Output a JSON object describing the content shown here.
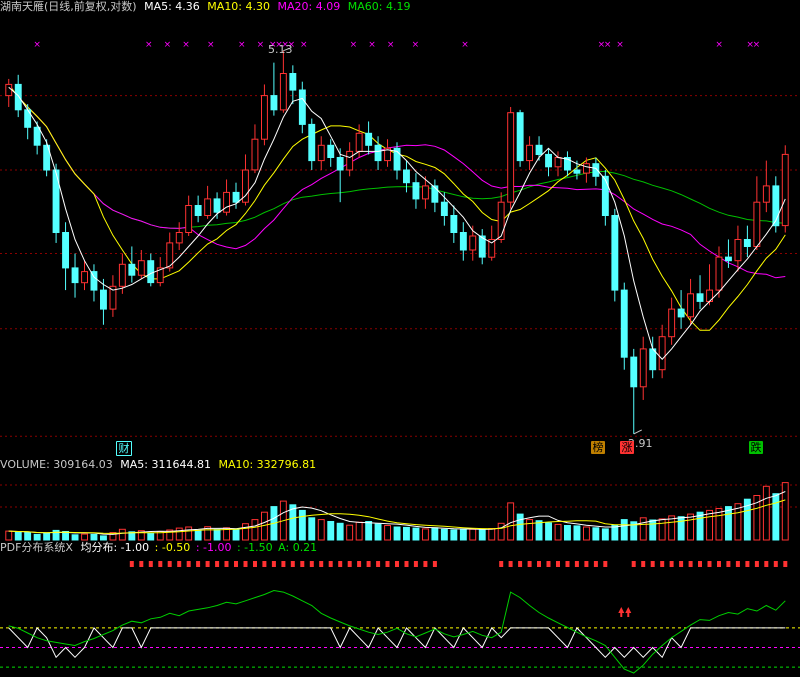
{
  "main_header": {
    "title": "湖南天雁(日线,前复权,对数)",
    "ma5": "MA5: 4.36",
    "ma10": "MA10: 4.30",
    "ma20": "MA20: 4.09",
    "ma60": "MA60: 4.19"
  },
  "volume_header": {
    "title": "VOLUME: 309164.03",
    "ma5": "MA5: 311644.81",
    "ma10": "MA10: 332796.81"
  },
  "indicator_header": {
    "title": "PDF分布系统X",
    "avg": "均分布: -1.00",
    "v1": ": -0.50",
    "v2": ": -1.00",
    "v3": ": -1.50",
    "a": "A: 0.21"
  },
  "annotations": {
    "high_label": "5.13",
    "low_label": "2.91",
    "tag_cai": "财",
    "tag_bang": "榜",
    "tag_zhang": "涨",
    "tag_die": "跌"
  },
  "colors": {
    "background": "#000000",
    "up": "#ff3232",
    "down": "#54ffff",
    "ma5": "#ffffff",
    "ma10": "#ffff00",
    "ma20": "#ff00ff",
    "ma60": "#00c000",
    "grid": "#8b0000"
  },
  "chart_data": [
    {
      "type": "candlestick",
      "title": "湖南天雁(日线,前复权,对数)",
      "scale": "log",
      "ylim": [
        2.85,
        5.4
      ],
      "high": 5.13,
      "low": 2.91,
      "candles": [
        [
          4.8,
          4.88,
          4.92,
          4.72
        ],
        [
          4.88,
          4.7,
          4.95,
          4.65
        ],
        [
          4.7,
          4.58,
          4.74,
          4.5
        ],
        [
          4.58,
          4.46,
          4.62,
          4.4
        ],
        [
          4.46,
          4.3,
          4.5,
          4.26
        ],
        [
          4.3,
          3.92,
          4.34,
          3.86
        ],
        [
          3.92,
          3.72,
          3.98,
          3.6
        ],
        [
          3.72,
          3.64,
          3.8,
          3.56
        ],
        [
          3.64,
          3.7,
          3.76,
          3.6
        ],
        [
          3.7,
          3.6,
          3.74,
          3.54
        ],
        [
          3.6,
          3.5,
          3.66,
          3.42
        ],
        [
          3.5,
          3.62,
          3.68,
          3.46
        ],
        [
          3.62,
          3.74,
          3.8,
          3.58
        ],
        [
          3.74,
          3.68,
          3.84,
          3.64
        ],
        [
          3.68,
          3.76,
          3.82,
          3.66
        ],
        [
          3.76,
          3.64,
          3.8,
          3.62
        ],
        [
          3.64,
          3.72,
          3.78,
          3.62
        ],
        [
          3.72,
          3.86,
          3.92,
          3.7
        ],
        [
          3.86,
          3.92,
          3.98,
          3.82
        ],
        [
          3.92,
          4.08,
          4.14,
          3.9
        ],
        [
          4.08,
          4.02,
          4.14,
          3.98
        ],
        [
          4.02,
          4.12,
          4.2,
          4.0
        ],
        [
          4.12,
          4.04,
          4.16,
          4.0
        ],
        [
          4.04,
          4.16,
          4.24,
          4.02
        ],
        [
          4.16,
          4.1,
          4.22,
          4.06
        ],
        [
          4.1,
          4.3,
          4.4,
          4.08
        ],
        [
          4.3,
          4.5,
          4.6,
          4.28
        ],
        [
          4.5,
          4.8,
          4.88,
          4.46
        ],
        [
          4.8,
          4.7,
          5.04,
          4.66
        ],
        [
          4.7,
          4.96,
          5.13,
          4.68
        ],
        [
          4.96,
          4.84,
          5.02,
          4.74
        ],
        [
          4.84,
          4.6,
          4.9,
          4.54
        ],
        [
          4.6,
          4.36,
          4.64,
          4.3
        ],
        [
          4.36,
          4.46,
          4.52,
          4.3
        ],
        [
          4.46,
          4.38,
          4.5,
          4.32
        ],
        [
          4.38,
          4.3,
          4.44,
          4.1
        ],
        [
          4.3,
          4.42,
          4.48,
          4.26
        ],
        [
          4.42,
          4.54,
          4.6,
          4.38
        ],
        [
          4.54,
          4.46,
          4.62,
          4.4
        ],
        [
          4.46,
          4.36,
          4.52,
          4.3
        ],
        [
          4.36,
          4.44,
          4.5,
          4.32
        ],
        [
          4.44,
          4.3,
          4.48,
          4.24
        ],
        [
          4.3,
          4.22,
          4.36,
          4.16
        ],
        [
          4.22,
          4.12,
          4.28,
          4.06
        ],
        [
          4.12,
          4.2,
          4.26,
          4.06
        ],
        [
          4.2,
          4.1,
          4.24,
          4.04
        ],
        [
          4.1,
          4.02,
          4.16,
          3.96
        ],
        [
          4.02,
          3.92,
          4.08,
          3.86
        ],
        [
          3.92,
          3.82,
          3.98,
          3.76
        ],
        [
          3.82,
          3.9,
          3.96,
          3.76
        ],
        [
          3.9,
          3.78,
          3.94,
          3.74
        ],
        [
          3.78,
          3.88,
          3.96,
          3.76
        ],
        [
          3.88,
          4.1,
          4.16,
          3.86
        ],
        [
          4.1,
          4.68,
          4.72,
          4.06
        ],
        [
          4.68,
          4.36,
          4.7,
          4.32
        ],
        [
          4.36,
          4.46,
          4.52,
          4.3
        ],
        [
          4.46,
          4.4,
          4.52,
          4.36
        ],
        [
          4.4,
          4.32,
          4.44,
          4.26
        ],
        [
          4.32,
          4.38,
          4.42,
          4.26
        ],
        [
          4.38,
          4.3,
          4.42,
          4.26
        ],
        [
          4.3,
          4.28,
          4.36,
          4.24
        ],
        [
          4.28,
          4.34,
          4.38,
          4.22
        ],
        [
          4.34,
          4.26,
          4.38,
          4.2
        ],
        [
          4.26,
          4.02,
          4.3,
          3.96
        ],
        [
          4.02,
          3.6,
          4.06,
          3.54
        ],
        [
          3.6,
          3.26,
          3.64,
          3.2
        ],
        [
          3.26,
          3.12,
          3.3,
          2.91
        ],
        [
          3.12,
          3.3,
          3.36,
          3.06
        ],
        [
          3.3,
          3.2,
          3.36,
          3.16
        ],
        [
          3.2,
          3.36,
          3.42,
          3.16
        ],
        [
          3.36,
          3.5,
          3.56,
          3.32
        ],
        [
          3.5,
          3.46,
          3.6,
          3.4
        ],
        [
          3.46,
          3.58,
          3.66,
          3.42
        ],
        [
          3.58,
          3.54,
          3.68,
          3.5
        ],
        [
          3.54,
          3.6,
          3.74,
          3.52
        ],
        [
          3.6,
          3.78,
          3.84,
          3.56
        ],
        [
          3.78,
          3.76,
          3.88,
          3.72
        ],
        [
          3.76,
          3.88,
          3.96,
          3.7
        ],
        [
          3.88,
          3.84,
          3.96,
          3.78
        ],
        [
          3.84,
          4.1,
          4.26,
          3.82
        ],
        [
          4.1,
          4.2,
          4.36,
          4.04
        ],
        [
          4.2,
          3.96,
          4.26,
          3.92
        ],
        [
          3.96,
          4.4,
          4.46,
          3.92
        ]
      ],
      "ma5": [
        4.86,
        4.8,
        4.7,
        4.6,
        4.48,
        4.28,
        4.06,
        3.88,
        3.76,
        3.67,
        3.63,
        3.6,
        3.61,
        3.63,
        3.66,
        3.69,
        3.71,
        3.73,
        3.78,
        3.84,
        3.9,
        3.97,
        4.03,
        4.07,
        4.09,
        4.14,
        4.22,
        4.37,
        4.5,
        4.65,
        4.76,
        4.78,
        4.69,
        4.64,
        4.52,
        4.4,
        4.38,
        4.42,
        4.42,
        4.42,
        4.43,
        4.42,
        4.36,
        4.29,
        4.24,
        4.19,
        4.13,
        4.07,
        4.01,
        3.93,
        3.89,
        3.86,
        3.9,
        4.05,
        4.16,
        4.28,
        4.38,
        4.44,
        4.38,
        4.37,
        4.34,
        4.32,
        4.31,
        4.24,
        4.1,
        3.9,
        3.65,
        3.46,
        3.3,
        3.25,
        3.3,
        3.36,
        3.42,
        3.49,
        3.54,
        3.59,
        3.65,
        3.71,
        3.77,
        3.84,
        3.91,
        3.99,
        4.12
      ]
    },
    {
      "type": "bar",
      "title": "VOLUME: 309164.03",
      "series": [
        {
          "values": [
            48,
            44,
            40,
            30,
            36,
            52,
            46,
            28,
            32,
            30,
            22,
            40,
            58,
            44,
            50,
            38,
            46,
            54,
            64,
            70,
            52,
            72,
            56,
            66,
            58,
            88,
            110,
            150,
            180,
            210,
            190,
            160,
            120,
            110,
            100,
            90,
            80,
            96,
            100,
            86,
            78,
            70,
            68,
            64,
            60,
            66,
            58,
            54,
            60,
            58,
            56,
            62,
            90,
            200,
            140,
            110,
            104,
            92,
            84,
            78,
            76,
            70,
            66,
            60,
            80,
            110,
            98,
            120,
            108,
            114,
            130,
            126,
            140,
            150,
            160,
            170,
            180,
            196,
            220,
            240,
            290,
            250,
            310
          ]
        }
      ],
      "ylim": [
        0,
        340
      ]
    },
    {
      "type": "line",
      "title": "PDF分布系统X",
      "series": [
        {
          "name": "A",
          "values": [
            0.1,
            0.04,
            -0.08,
            -0.2,
            -0.28,
            -0.32,
            -0.36,
            -0.4,
            -0.3,
            -0.22,
            -0.12,
            -0.02,
            0.12,
            0.22,
            0.18,
            0.28,
            0.32,
            0.42,
            0.36,
            0.48,
            0.52,
            0.56,
            0.62,
            0.7,
            0.66,
            0.74,
            0.82,
            0.9,
            1.0,
            0.96,
            0.86,
            0.74,
            0.62,
            0.42,
            0.3,
            0.2,
            0.1,
            0.02,
            -0.06,
            -0.12,
            -0.06,
            0.04,
            -0.1,
            -0.18,
            -0.08,
            0.02,
            -0.1,
            -0.18,
            -0.12,
            -0.04,
            -0.14,
            -0.2,
            -0.06,
            0.96,
            0.82,
            0.62,
            0.44,
            0.3,
            0.18,
            0.06,
            -0.06,
            -0.18,
            -0.28,
            -0.4,
            -0.7,
            -1.0,
            -1.1,
            -0.9,
            -0.62,
            -0.4,
            -0.2,
            -0.04,
            0.12,
            0.26,
            0.24,
            0.36,
            0.44,
            0.4,
            0.54,
            0.48,
            0.62,
            0.5,
            0.74
          ]
        }
      ],
      "levels": [
        -0.5,
        -1.0,
        -1.5
      ],
      "ylim": [
        -1.7,
        1.1
      ]
    }
  ]
}
